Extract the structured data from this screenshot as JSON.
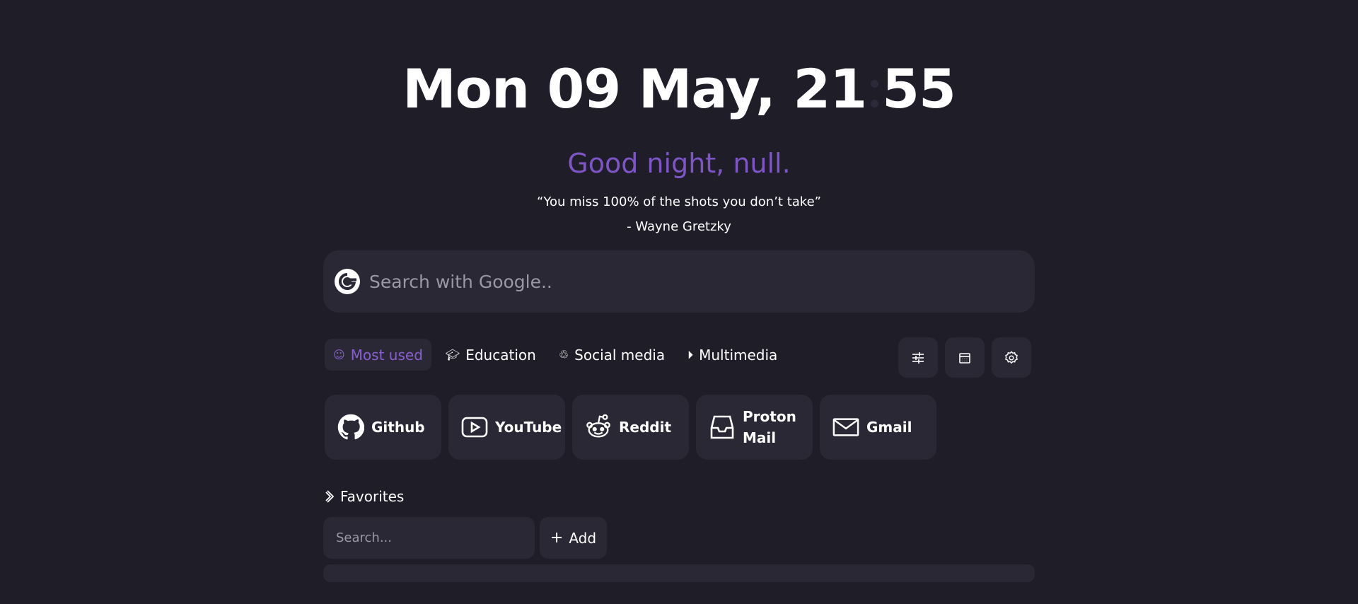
{
  "clock": {
    "date_text": "Mon 09 May, 21",
    "minutes": "55"
  },
  "greeting": "Good night, null.",
  "quote": {
    "text": "“You miss 100% of the shots you don’t take”",
    "author": "- Wayne Gretzky"
  },
  "search": {
    "placeholder": "Search with Google..",
    "icon": "google-icon"
  },
  "tabs": [
    {
      "label": "Most used",
      "icon": "smile-icon",
      "active": true
    },
    {
      "label": "Education",
      "icon": "graduation-cap-icon",
      "active": false
    },
    {
      "label": "Social media",
      "icon": "recycle-icon",
      "active": false
    },
    {
      "label": "Multimedia",
      "icon": "play-circle-icon",
      "active": false
    }
  ],
  "tools": [
    {
      "icon": "sliders-icon"
    },
    {
      "icon": "calendar-icon"
    },
    {
      "icon": "gear-icon"
    }
  ],
  "links": [
    {
      "label": "Github",
      "icon": "github-icon"
    },
    {
      "label": "YouTube",
      "icon": "youtube-icon"
    },
    {
      "label": "Reddit",
      "icon": "reddit-icon"
    },
    {
      "label": "Proton Mail",
      "icon": "inbox-icon"
    },
    {
      "label": "Gmail",
      "icon": "mail-icon"
    }
  ],
  "favorites": {
    "title": "Favorites",
    "search_placeholder": "Search...",
    "add_label": "Add"
  },
  "colors": {
    "background": "#1f1d28",
    "card": "#2a2834",
    "accent": "#7d55c7"
  }
}
